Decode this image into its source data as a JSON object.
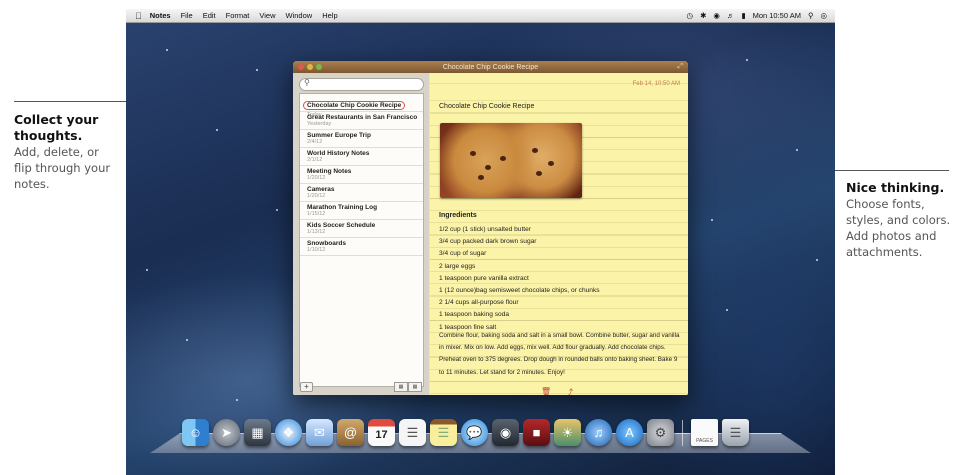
{
  "callouts": {
    "left": {
      "title": "Collect your thoughts.",
      "body": "Add, delete, or flip through your notes."
    },
    "right": {
      "title": "Nice thinking.",
      "body": "Choose fonts, styles, and colors. Add photos and attachments."
    }
  },
  "menubar": {
    "apple": "",
    "app": "Notes",
    "items": [
      "File",
      "Edit",
      "Format",
      "View",
      "Window",
      "Help"
    ],
    "clock": "Mon 10:50 AM"
  },
  "window": {
    "title": "Chocolate Chip Cookie Recipe"
  },
  "notes": [
    {
      "title": "Chocolate Chip Cookie Recipe",
      "date": "Today"
    },
    {
      "title": "Great Restaurants in San Francisco",
      "date": "Yesterday"
    },
    {
      "title": "Summer Europe Trip",
      "date": "2/4/12"
    },
    {
      "title": "World History Notes",
      "date": "2/1/12"
    },
    {
      "title": "Meeting Notes",
      "date": "1/20/12"
    },
    {
      "title": "Cameras",
      "date": "1/20/12"
    },
    {
      "title": "Marathon Training Log",
      "date": "1/15/12"
    },
    {
      "title": "Kids Soccer Schedule",
      "date": "1/13/12"
    },
    {
      "title": "Snowboards",
      "date": "1/10/12"
    }
  ],
  "note": {
    "date": "Feb 14, 10:50 AM",
    "title": "Chocolate Chip Cookie Recipe",
    "ingredients_heading": "Ingredients",
    "ingredients": [
      "1/2 cup (1 stick) unsalted butter",
      "3/4 cup packed dark brown sugar",
      "3/4 cup of sugar",
      "2 large eggs",
      "1 teaspoon pure vanilla extract",
      "1 (12 ounce)bag semisweet chocolate chips, or chunks",
      "2 1/4 cups all-purpose flour",
      "1 teaspoon baking soda",
      "1 teaspoon fine salt"
    ],
    "directions": "Combine flour, baking soda and salt in a small bowl. Combine butter, sugar and vanilla in mixer. Mix on low. Add eggs, mix well. Add flour gradually. Add chocolate chips. Preheat oven to 375 degrees. Drop dough in rounded balls onto baking sheet. Bake 9 to 11 minutes. Let stand for 2 minutes. Enjoy!"
  },
  "sidebar_bottom": {
    "add_label": "+"
  },
  "dock": [
    "finder-icon",
    "launchpad-icon",
    "mission-control-icon",
    "safari-icon",
    "mail-icon",
    "contacts-icon",
    "calendar-icon",
    "reminders-icon",
    "notes-icon",
    "messages-icon",
    "facetime-icon",
    "photo-booth-icon",
    "iphoto-icon",
    "itunes-icon",
    "app-store-icon",
    "system-preferences-icon",
    "document-icon",
    "trash-icon"
  ],
  "dock_calendar_day": "17",
  "dock_doc_label": "PAGES"
}
